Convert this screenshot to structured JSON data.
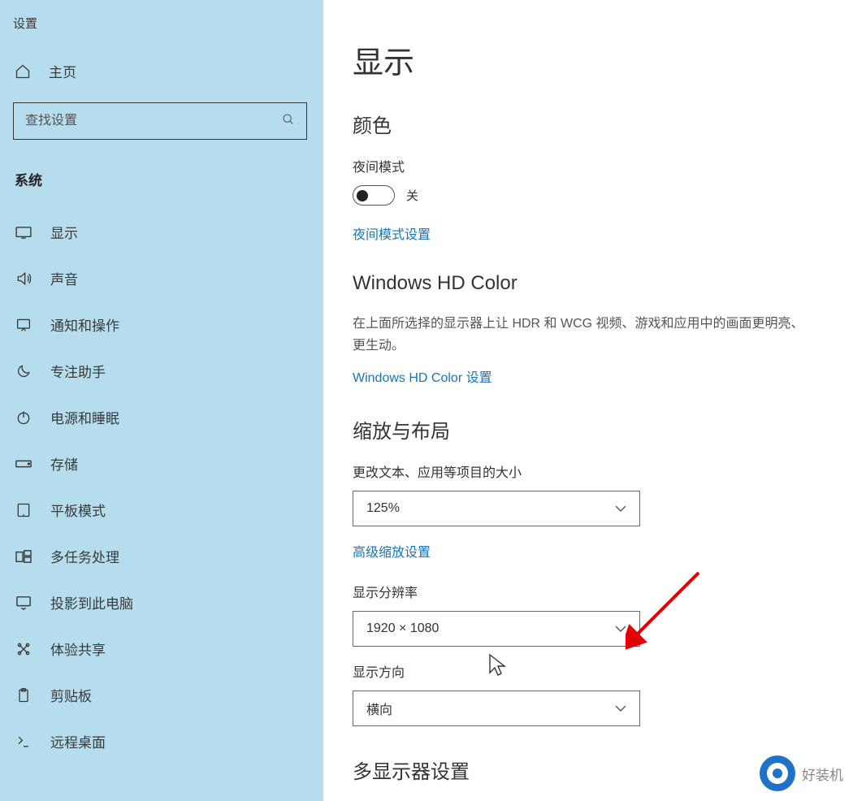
{
  "sidebar": {
    "app_title": "设置",
    "home_label": "主页",
    "search_placeholder": "查找设置",
    "category": "系统",
    "items": [
      {
        "name": "display",
        "label": "显示"
      },
      {
        "name": "sound",
        "label": "声音"
      },
      {
        "name": "notifications",
        "label": "通知和操作"
      },
      {
        "name": "focus",
        "label": "专注助手"
      },
      {
        "name": "power",
        "label": "电源和睡眠"
      },
      {
        "name": "storage",
        "label": "存储"
      },
      {
        "name": "tablet",
        "label": "平板模式"
      },
      {
        "name": "multitask",
        "label": "多任务处理"
      },
      {
        "name": "projecting",
        "label": "投影到此电脑"
      },
      {
        "name": "shared",
        "label": "体验共享"
      },
      {
        "name": "clipboard",
        "label": "剪贴板"
      },
      {
        "name": "remote",
        "label": "远程桌面"
      }
    ]
  },
  "main": {
    "title": "显示",
    "color": {
      "heading": "颜色",
      "night_light_label": "夜间模式",
      "toggle_state": "关",
      "night_link": "夜间模式设置"
    },
    "hd": {
      "heading": "Windows HD Color",
      "desc": "在上面所选择的显示器上让 HDR 和 WCG 视频、游戏和应用中的画面更明亮、更生动。",
      "link": "Windows HD Color 设置"
    },
    "scale": {
      "heading": "缩放与布局",
      "scale_label": "更改文本、应用等项目的大小",
      "scale_value": "125%",
      "advanced_link": "高级缩放设置",
      "resolution_label": "显示分辨率",
      "resolution_value": "1920 × 1080",
      "orientation_label": "显示方向",
      "orientation_value": "横向"
    },
    "multi_heading": "多显示器设置"
  },
  "watermark": "好装机"
}
